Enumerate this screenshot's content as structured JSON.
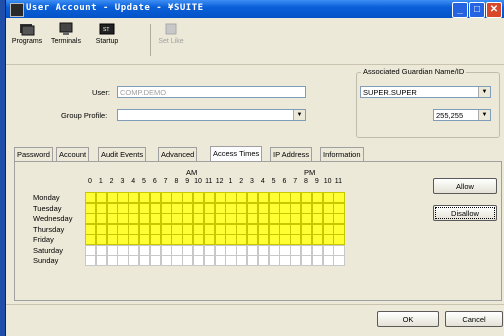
{
  "window": {
    "title": "User Account - Update - ¥SUITE",
    "controls": [
      "minimize",
      "maximize",
      "close"
    ]
  },
  "toolbar": {
    "items": [
      {
        "label": "Programs",
        "icon": "programs-icon",
        "enabled": true
      },
      {
        "label": "Terminals",
        "icon": "terminals-icon",
        "enabled": true
      },
      {
        "label": "Startup",
        "icon": "startup-icon",
        "enabled": true
      },
      {
        "label": "Set Like",
        "icon": "set-like-icon",
        "enabled": false
      }
    ]
  },
  "form": {
    "user_label": "User:",
    "user_value": "COMP.DEMO",
    "group_profile_label": "Group Profile:",
    "group_profile_value": "",
    "guardian_label": "Associated Guardian Name/ID",
    "guardian_value": "SUPER.SUPER",
    "guardian_id_value": "255,255"
  },
  "tabs": [
    {
      "label": "Password",
      "active": false
    },
    {
      "label": "Account",
      "active": false
    },
    {
      "label": "Audit Events",
      "active": false
    },
    {
      "label": "Advanced",
      "active": false
    },
    {
      "label": "Access Times",
      "active": true
    },
    {
      "label": "IP Address",
      "active": false
    },
    {
      "label": "Information",
      "active": false
    }
  ],
  "access_times": {
    "am_label": "AM",
    "pm_label": "PM",
    "hours": [
      "0",
      "1",
      "2",
      "3",
      "4",
      "5",
      "6",
      "7",
      "8",
      "9",
      "10",
      "11",
      "12",
      "1",
      "2",
      "3",
      "4",
      "5",
      "6",
      "7",
      "8",
      "9",
      "10",
      "11"
    ],
    "days": [
      {
        "name": "Monday",
        "allowed": true
      },
      {
        "name": "Tuesday",
        "allowed": true
      },
      {
        "name": "Wednesday",
        "allowed": true
      },
      {
        "name": "Thursday",
        "allowed": true
      },
      {
        "name": "Friday",
        "allowed": true
      },
      {
        "name": "Saturday",
        "allowed": false
      },
      {
        "name": "Sunday",
        "allowed": false
      }
    ],
    "allowed_color": "#ffff33",
    "allow_label": "Allow",
    "disallow_label": "Disallow"
  },
  "buttons": {
    "ok": "OK",
    "cancel": "Cancel"
  }
}
